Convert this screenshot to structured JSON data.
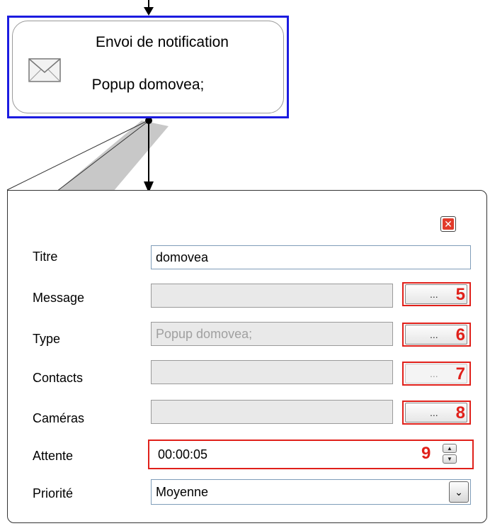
{
  "node": {
    "title": "Envoi de notification",
    "subtitle": "Popup domovea;",
    "icon": "envelope-icon"
  },
  "panel": {
    "close_icon": "close-icon",
    "fields": {
      "titre": {
        "label": "Titre",
        "value": "domovea"
      },
      "message": {
        "label": "Message",
        "value": "",
        "button": "...",
        "callout": "5"
      },
      "type": {
        "label": "Type",
        "value": "Popup domovea;",
        "button": "...",
        "callout": "6"
      },
      "contacts": {
        "label": "Contacts",
        "value": "",
        "button": "...",
        "callout": "7"
      },
      "cameras": {
        "label": "Caméras",
        "value": "",
        "button": "...",
        "callout": "8"
      },
      "attente": {
        "label": "Attente",
        "value": "00:00:05",
        "callout": "9"
      },
      "priorite": {
        "label": "Priorité",
        "value": "Moyenne"
      }
    }
  },
  "colors": {
    "selection_border": "#1c1ce0",
    "callout_red": "#e0201a",
    "close_red": "#e23a2a"
  }
}
